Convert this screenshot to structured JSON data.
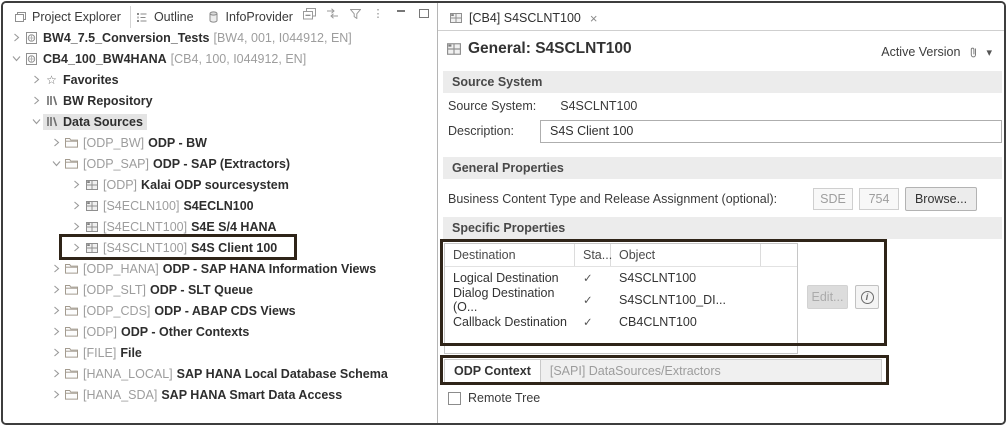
{
  "explorer": {
    "tabs": [
      {
        "label": "Project Explorer"
      },
      {
        "label": "Outline"
      },
      {
        "label": "InfoProvider"
      }
    ],
    "tree": {
      "items": [
        {
          "name": "BW4_7.5_Conversion_Tests",
          "suffix": "[BW4, 001, I044912, EN]"
        },
        {
          "name": "CB4_100_BW4HANA",
          "suffix": "[CB4, 100, I044912, EN]"
        },
        {
          "label": "Favorites"
        },
        {
          "label": "BW Repository"
        },
        {
          "label": "Data Sources"
        },
        {
          "tech": "[ODP_BW]",
          "label": "ODP - BW"
        },
        {
          "tech": "[ODP_SAP]",
          "label": "ODP - SAP (Extractors)"
        },
        {
          "tech": "[ODP]",
          "label": "Kalai ODP sourcesystem"
        },
        {
          "tech": "[S4ECLN100]",
          "label": "S4ECLN100"
        },
        {
          "tech": "[S4ECLNT100]",
          "label": "S4E S/4 HANA"
        },
        {
          "tech": "[S4SCLNT100]",
          "label": "S4S Client 100"
        },
        {
          "tech": "[ODP_HANA]",
          "label": "ODP - SAP HANA Information Views"
        },
        {
          "tech": "[ODP_SLT]",
          "label": "ODP - SLT Queue"
        },
        {
          "tech": "[ODP_CDS]",
          "label": "ODP - ABAP CDS Views"
        },
        {
          "tech": "[ODP]",
          "label": "ODP - Other Contexts"
        },
        {
          "tech": "[FILE]",
          "label": "File"
        },
        {
          "tech": "[HANA_LOCAL]",
          "label": "SAP HANA Local Database Schema"
        },
        {
          "tech": "[HANA_SDA]",
          "label": "SAP HANA Smart Data Access"
        }
      ]
    }
  },
  "editor": {
    "tab_label": "[CB4] S4SCLNT100",
    "title": "General: S4SCLNT100",
    "version_label": "Active Version",
    "source_system": {
      "header": "Source System",
      "name_label": "Source System:",
      "name_value": "S4SCLNT100",
      "description_label": "Description:",
      "description_value": "S4S Client 100"
    },
    "general_properties": {
      "header": "General Properties",
      "bct_label": "Business Content Type and Release Assignment (optional):",
      "type_value": "SDE",
      "release_value": "754",
      "browse_label": "Browse..."
    },
    "specific_properties": {
      "header": "Specific Properties",
      "table": {
        "columns": [
          "Destination",
          "Sta...",
          "Object"
        ],
        "rows": [
          {
            "destination": "Logical Destination",
            "status": "✓",
            "object": "S4SCLNT100"
          },
          {
            "destination": "Dialog Destination (O...",
            "status": "✓",
            "object": "S4SCLNT100_DI..."
          },
          {
            "destination": "Callback Destination",
            "status": "✓",
            "object": "CB4CLNT100"
          }
        ]
      },
      "edit_label": "Edit..."
    },
    "odp_context": {
      "label": "ODP Context",
      "value": "[SAPI] DataSources/Extractors"
    },
    "remote_tree_label": "Remote Tree"
  },
  "icons": {
    "close": "×",
    "dropdown": "▾",
    "star": "☆",
    "info": "i",
    "view_menu": "⋮"
  }
}
